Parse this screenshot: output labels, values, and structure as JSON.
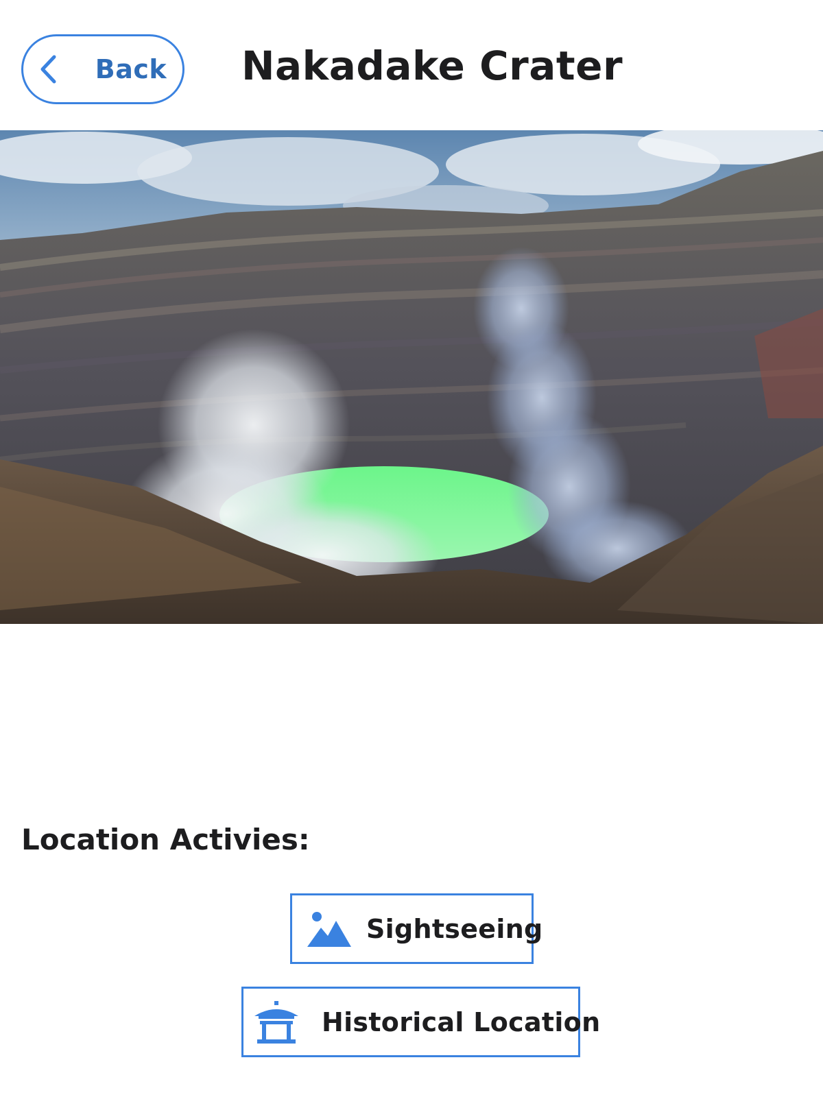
{
  "header": {
    "back_label": "Back",
    "back_icon": "chevron-left-icon",
    "title": "Nakadake Crater"
  },
  "hero_image": {
    "subject": "volcanic-crater-photo"
  },
  "activities": {
    "heading": "Location Activies:",
    "items": [
      {
        "label": "Sightseeing",
        "icon": "landscape-icon"
      },
      {
        "label": "Historical Location",
        "icon": "temple-icon"
      }
    ]
  },
  "colors": {
    "accent": "#3a82e0",
    "back_text": "#2f6db8",
    "text": "#1d1d1f",
    "background": "#ffffff"
  }
}
